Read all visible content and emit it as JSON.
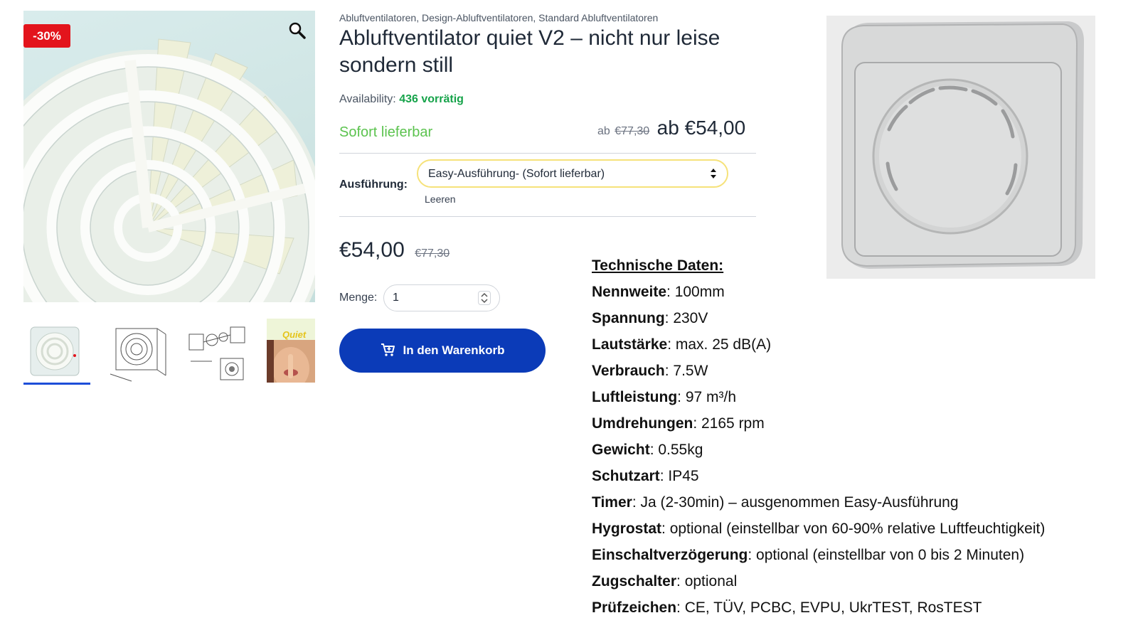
{
  "badge": {
    "sale": "-30%"
  },
  "breadcrumb": [
    "Abluftventilatoren",
    "Design-Abluftventilatoren",
    "Standard Abluftventilatoren"
  ],
  "breadcrumb_separator": ",",
  "product": {
    "title_line1": "Abluftventilator quiet V2 – nicht nur leise",
    "title_line2": "sondern still",
    "availability_label": "Availability:",
    "availability_value": "436 vorrätig",
    "delivery_status": "Sofort lieferbar",
    "price_range": {
      "prefix_small": "ab",
      "old": "€77,30",
      "new": "ab €54,00"
    },
    "variation": {
      "label": "Ausführung:",
      "selected": "Easy-Ausführung- (Sofort lieferbar)",
      "clear_label": "Leeren"
    },
    "price": {
      "new": "€54,00",
      "old": "€77,30"
    },
    "quantity": {
      "label": "Menge:",
      "value": "1"
    },
    "add_to_cart_label": "In den Warenkorb",
    "thumbnail_4_text": "Quiet"
  },
  "tech": {
    "title": "Technische Daten:",
    "specs": [
      {
        "name": "Nennweite",
        "value": ": 100mm"
      },
      {
        "name": "Spannung",
        "value": ": 230V"
      },
      {
        "name": "Lautstärke",
        "value": ": max. 25 dB(A)"
      },
      {
        "name": "Verbrauch",
        "value": ": 7.5W"
      },
      {
        "name": "Luftleistung",
        "value": ": 97 m³/h"
      },
      {
        "name": "Umdrehungen",
        "value": ": 2165 rpm"
      },
      {
        "name": "Gewicht",
        "value": ": 0.55kg"
      },
      {
        "name": "Schutzart",
        "value": ": IP45"
      },
      {
        "name": "Timer",
        "value": ": Ja (2-30min) – ausgenommen Easy-Ausführung"
      },
      {
        "name": "Hygrostat",
        "value": ": optional (einstellbar von 60-90% relative Luftfeuchtigkeit)"
      },
      {
        "name": "Einschaltverzögerung",
        "value": ": optional (einstellbar von 0 bis 2 Minuten)"
      },
      {
        "name": "Zugschalter",
        "value": ": optional"
      },
      {
        "name": "Prüfzeichen",
        "value": ": CE, TÜV, PCBC, EVPU, UkrTEST, RosTEST"
      }
    ]
  },
  "colors": {
    "sale_badge": "#e3141c",
    "in_stock": "#16a34a",
    "delivery": "#5cc34f",
    "cart_button": "#0b3bb8",
    "select_border": "#f6e27a"
  },
  "icons": {
    "zoom": "magnifier-icon",
    "cart": "cart-plus-icon",
    "select": "select-arrows-icon",
    "stepper": "stepper-arrows-icon"
  }
}
